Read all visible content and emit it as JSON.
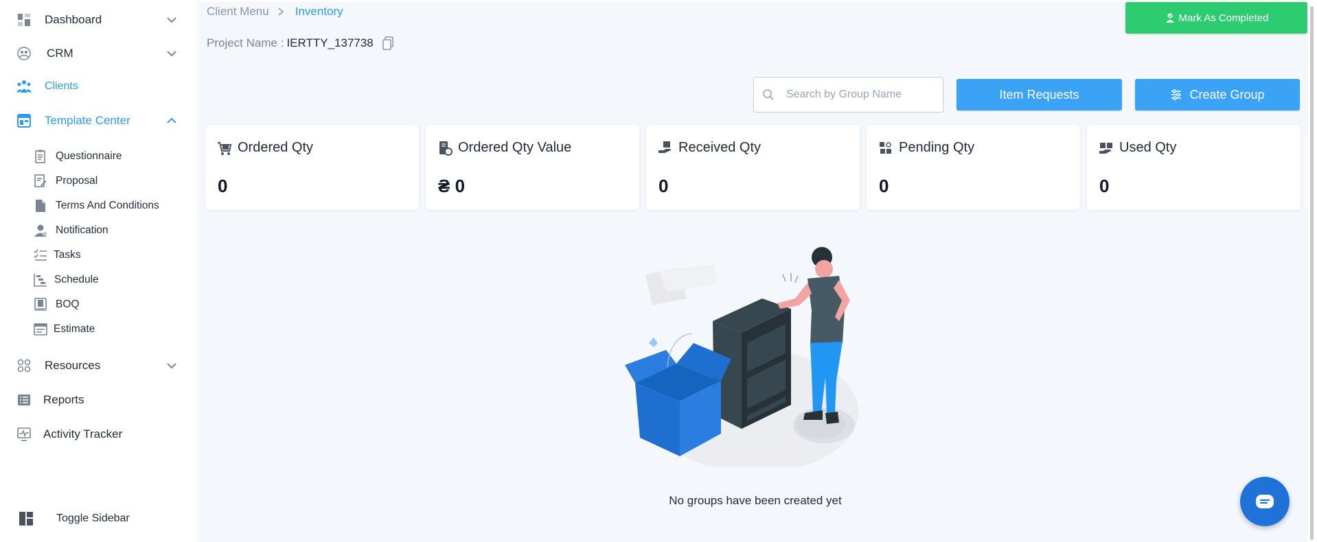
{
  "sidebar": {
    "items": [
      {
        "label": "Dashboard",
        "icon": "dashboard-icon",
        "has_chevron": true
      },
      {
        "label": "CRM",
        "icon": "crm-icon",
        "has_chevron": true
      },
      {
        "label": "Clients",
        "icon": "clients-icon",
        "active": true
      },
      {
        "label": "Template Center",
        "icon": "template-center-icon",
        "has_chevron": true,
        "expanded": true,
        "active": true
      },
      {
        "label": "Resources",
        "icon": "resources-icon",
        "has_chevron": true
      },
      {
        "label": "Reports",
        "icon": "reports-icon"
      },
      {
        "label": "Activity Tracker",
        "icon": "activity-tracker-icon"
      }
    ],
    "subitems": [
      {
        "label": "Questionnaire",
        "icon": "questionnaire-icon"
      },
      {
        "label": "Proposal",
        "icon": "proposal-icon"
      },
      {
        "label": "Terms And Conditions",
        "icon": "document-icon"
      },
      {
        "label": "Notification",
        "icon": "notification-icon"
      },
      {
        "label": "Tasks",
        "icon": "tasks-icon"
      },
      {
        "label": "Schedule",
        "icon": "schedule-icon"
      },
      {
        "label": "BOQ",
        "icon": "boq-icon"
      },
      {
        "label": "Estimate",
        "icon": "estimate-icon"
      }
    ],
    "toggle_label": "Toggle Sidebar"
  },
  "breadcrumb": {
    "parent": "Client Menu",
    "current": "Inventory"
  },
  "project": {
    "label": "Project Name :",
    "value": "IERTTY_137738"
  },
  "header": {
    "complete_label": "Mark As Completed"
  },
  "search": {
    "placeholder": "Search by Group Name"
  },
  "buttons": {
    "item_requests": "Item Requests",
    "create_group": "Create Group"
  },
  "stats": [
    {
      "title": "Ordered Qty",
      "value": "0",
      "icon": "cart-icon"
    },
    {
      "title": "Ordered Qty Value",
      "value": "₴ 0",
      "icon": "bill-icon"
    },
    {
      "title": "Received Qty",
      "value": "0",
      "icon": "hand-box-icon"
    },
    {
      "title": "Pending Qty",
      "value": "0",
      "icon": "boxes-icon"
    },
    {
      "title": "Used Qty",
      "value": "0",
      "icon": "used-box-icon"
    }
  ],
  "empty_state": {
    "message": "No groups have been created yet",
    "illustration": "empty-shelf-illustration"
  },
  "colors": {
    "accent": "#3aa3f5",
    "success": "#2ecc71",
    "active_text": "#2f9bf0",
    "chat": "#1f73d8",
    "background": "#f4f8fd"
  }
}
